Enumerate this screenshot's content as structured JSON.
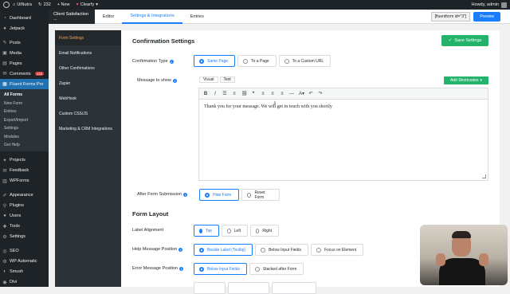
{
  "adminbar": {
    "site_name": "UiNutra",
    "updates": "232",
    "new_label": "+ New",
    "plugin_label": "Clearfy",
    "howdy": "Howdy, admin"
  },
  "sidebar": {
    "items": [
      {
        "label": "Dashboard",
        "icon": "dashboard-icon"
      },
      {
        "label": "Jetpack",
        "icon": "jetpack-icon"
      },
      {
        "label": "Posts",
        "icon": "pin-icon"
      },
      {
        "label": "Media",
        "icon": "media-icon"
      },
      {
        "label": "Pages",
        "icon": "pages-icon"
      },
      {
        "label": "Comments",
        "icon": "comment-icon",
        "badge": "132"
      },
      {
        "label": "Fluent Forms Pro",
        "icon": "fluent-forms-icon"
      }
    ],
    "submenu": [
      "All Forms",
      "New Form",
      "Entries",
      "Export/Import",
      "Settings",
      "Modules",
      "Get Help"
    ],
    "items_bottom": [
      {
        "label": "Projects",
        "icon": "projects-icon"
      },
      {
        "label": "Feedback",
        "icon": "feedback-icon"
      },
      {
        "label": "WPForms",
        "icon": "wpforms-icon"
      },
      {
        "label": "Appearance",
        "icon": "brush-icon"
      },
      {
        "label": "Plugins",
        "icon": "plugin-icon"
      },
      {
        "label": "Users",
        "icon": "users-icon"
      },
      {
        "label": "Tools",
        "icon": "tools-icon"
      },
      {
        "label": "Settings",
        "icon": "settings-icon"
      },
      {
        "label": "SEO",
        "icon": "seo-icon"
      },
      {
        "label": "WP Automatic",
        "icon": "automatic-icon"
      },
      {
        "label": "Smush",
        "icon": "smush-icon"
      },
      {
        "label": "Divi",
        "icon": "divi-icon"
      }
    ]
  },
  "topnav": {
    "form_title": "Client Satisfaction ...",
    "tabs": [
      "Editor",
      "Settings & Integrations",
      "Entries"
    ],
    "shortcode": "[fluentform id=\"3\"]",
    "preview": "Preview"
  },
  "settings_nav": [
    "Form Settings",
    "Email Notifications",
    "Other Confirmations",
    "Zapier",
    "WebHook",
    "Custom CSS/JS",
    "Marketing & CRM Integrations"
  ],
  "confirmation": {
    "title": "Confirmation Settings",
    "save": "Save Settings",
    "type_label": "Confirmation Type",
    "type_options": [
      "Same Page",
      "To a Page",
      "To a Custom URL"
    ],
    "message_label": "Message to show",
    "editor_tabs": [
      "Visual",
      "Text"
    ],
    "add_shortcodes": "Add Shortcodes",
    "message": "Thank you for your message. We will get in touch with you shortly",
    "after_submit_label": "After Form Submission",
    "after_submit_options": [
      "Hide Form",
      "Reset Form"
    ]
  },
  "layout": {
    "title": "Form Layout",
    "label_alignment_label": "Label Alignment",
    "label_alignment_options": [
      "Top",
      "Left",
      "Right"
    ],
    "help_position_label": "Help Message Position",
    "help_position_options": [
      "Beside Label (Tooltip)",
      "Below Input Fields",
      "Focus on Element"
    ],
    "error_position_label": "Error Message Position",
    "error_position_options": [
      "Below Input Fields",
      "Stacked after Form"
    ]
  }
}
